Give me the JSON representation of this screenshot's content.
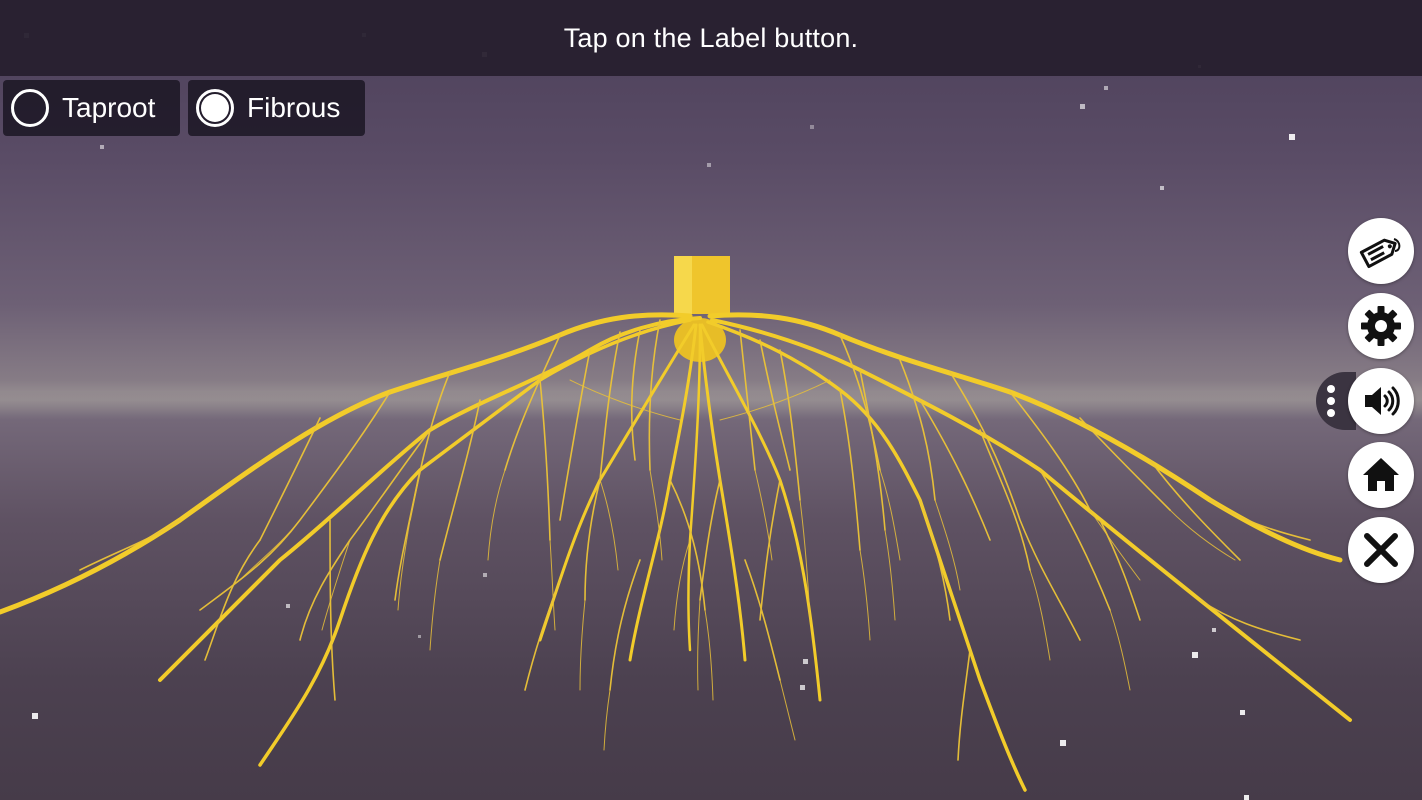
{
  "header": {
    "instruction": "Tap on the Label button."
  },
  "root_options": [
    {
      "label": "Taproot",
      "selected": false
    },
    {
      "label": "Fibrous",
      "selected": true
    }
  ],
  "root_color": "#f2cc2a",
  "side_toolbar": {
    "buttons": [
      {
        "name": "label",
        "icon": "tag-icon"
      },
      {
        "name": "settings",
        "icon": "gear-icon"
      },
      {
        "name": "sound",
        "icon": "speaker-icon"
      },
      {
        "name": "home",
        "icon": "home-icon"
      },
      {
        "name": "close",
        "icon": "close-icon"
      }
    ],
    "more_icon": "vertical-dots-icon"
  }
}
